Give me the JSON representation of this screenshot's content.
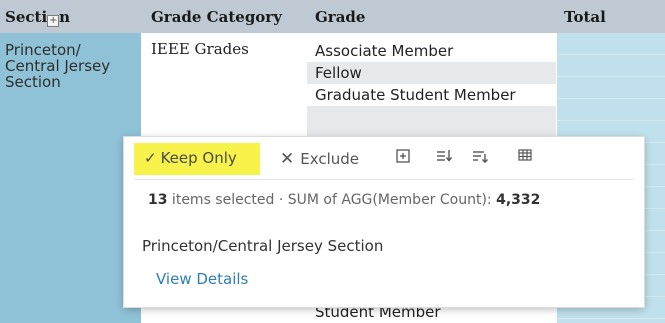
{
  "header": {
    "section": "Secti",
    "section_tail": "n",
    "grade_category": "Grade Category",
    "grade": "Grade",
    "total": "Total"
  },
  "section_value": "Princeton/ Central Jersey Section",
  "grade_category_value": "IEEE Grades",
  "grades": [
    "Associate Member",
    "Fellow",
    "Graduate Student Member",
    "Student Member"
  ],
  "tooltip": {
    "keep_only": "Keep Only",
    "exclude": "Exclude",
    "items_count": "13",
    "items_text": " items selected  ·  SUM of AGG(Member Count): ",
    "sum_value": "4,332",
    "section_name": "Princeton/Central Jersey Section",
    "view_details": "View Details"
  },
  "colors": {
    "header_bg": "#bfc9d3",
    "section_bg": "#8fc2d6",
    "total_bg": "#bfe0ec",
    "keep_highlight": "#f8f34a",
    "link": "#2e7fb8"
  }
}
